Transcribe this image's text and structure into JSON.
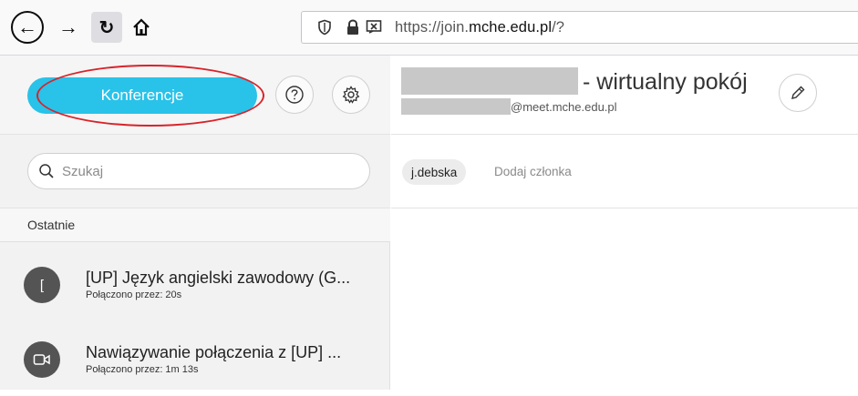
{
  "browser": {
    "back_icon": "arrow-left",
    "forward_icon": "arrow-right",
    "reload_icon": "reload",
    "home_icon": "home",
    "url_prefix": "https://join.",
    "url_domain": "mche.edu.pl",
    "url_suffix": "/?"
  },
  "sidebar": {
    "conferences_label": "Konferencje",
    "search_placeholder": "Szukaj",
    "recent_label": "Ostatnie",
    "recent_items": [
      {
        "avatar": "[",
        "title": "[UP] Język angielski zawodowy (G...",
        "subtitle": "Połączono przez: 20s"
      },
      {
        "avatar_icon": "video-camera",
        "title": "Nawiązywanie połączenia z [UP] ...",
        "subtitle": "Połączono przez: 1m 13s"
      }
    ]
  },
  "main": {
    "room_title": "- wirtualny pokój",
    "room_email": "@meet.mche.edu.pl",
    "member_chip": "j.debska",
    "add_member": "Dodaj członka"
  },
  "colors": {
    "accent": "#29c2e9",
    "annotation": "#d9232a",
    "avatar": "#545454"
  }
}
